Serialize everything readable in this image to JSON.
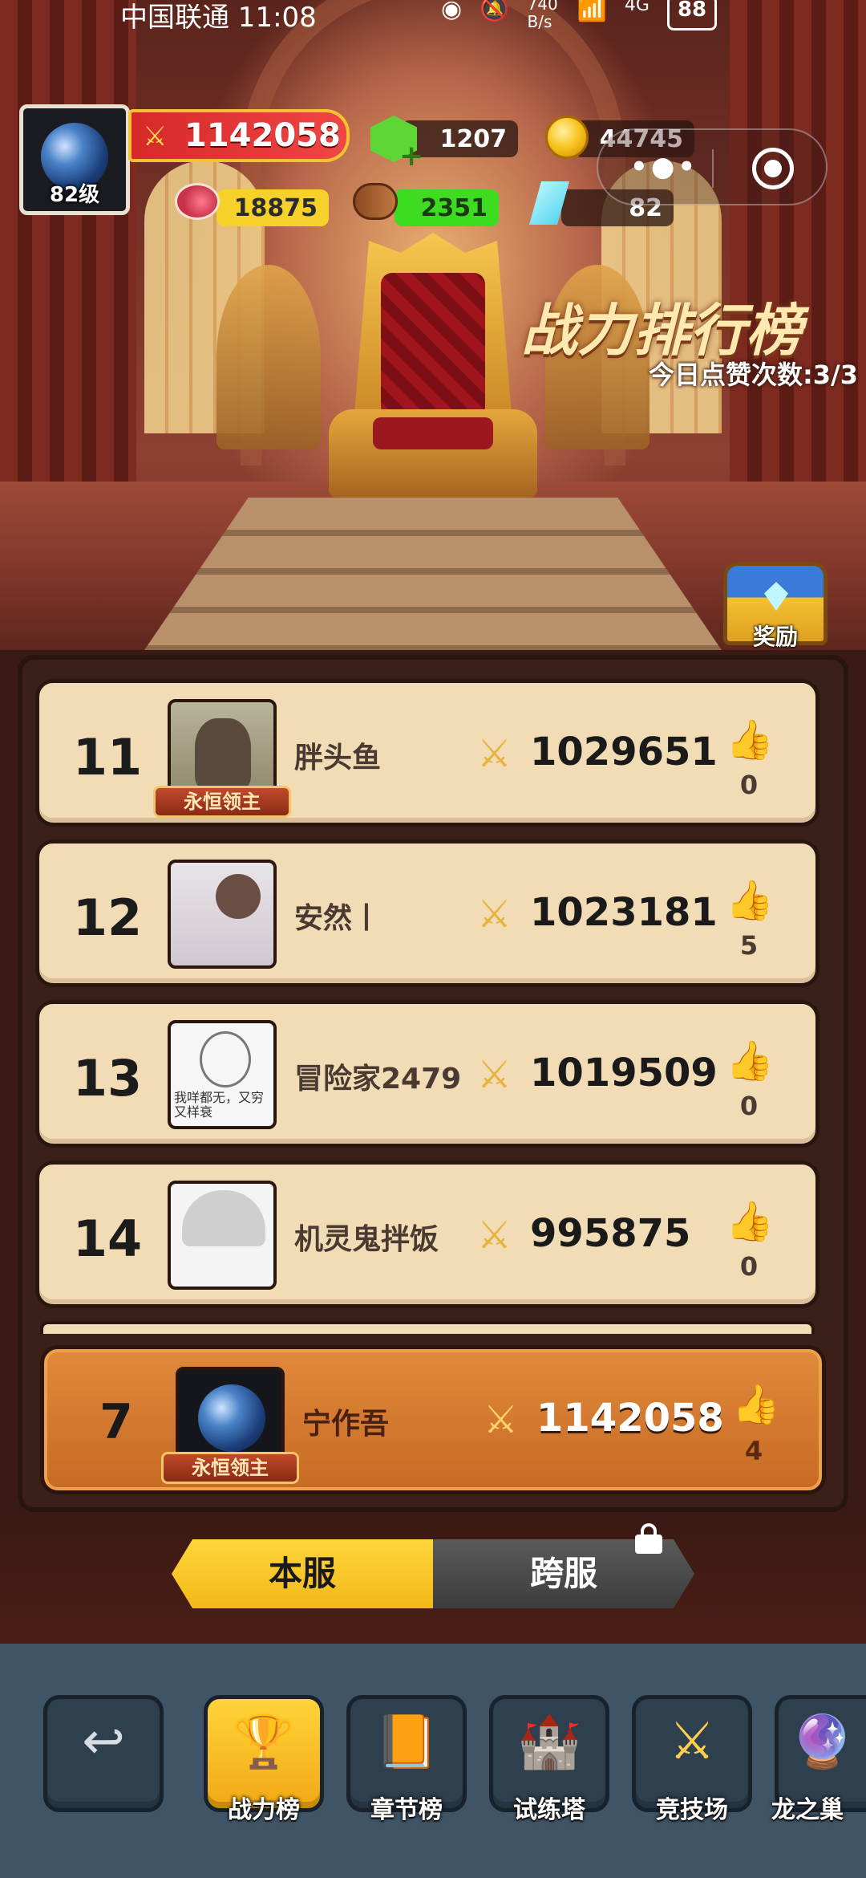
{
  "status_bar": {
    "carrier_time": "中国联通 11:08",
    "net_speed": "740 B/s",
    "network": "4G",
    "battery": "88"
  },
  "player": {
    "level": "82级",
    "power": "1142058"
  },
  "resources": {
    "green_gem": "1207",
    "gold": "44745",
    "food": "18875",
    "wood": "2351",
    "diamond": "82"
  },
  "capsule": {
    "more_icon": "more-dots-icon",
    "close_icon": "target-circle-icon"
  },
  "board": {
    "title": "战力排行榜",
    "likes_today": "今日点赞次数:3/3",
    "reward_label": "奖励"
  },
  "rows": [
    {
      "rank": "11",
      "name": "胖头鱼",
      "power": "1029651",
      "likes": "0",
      "tag": "永恒领主"
    },
    {
      "rank": "12",
      "name": "安然丨",
      "power": "1023181",
      "likes": "5"
    },
    {
      "rank": "13",
      "name": "冒险家2479",
      "power": "1019509",
      "likes": "0",
      "avatar_caption": "我咩都无，又穷又样衰"
    },
    {
      "rank": "14",
      "name": "机灵鬼拌饭",
      "power": "995875",
      "likes": "0"
    }
  ],
  "self_row": {
    "rank": "7",
    "name": "宁作吾",
    "power": "1142058",
    "likes": "4",
    "tag": "永恒领主"
  },
  "server_switch": {
    "local": "本服",
    "cross": "跨服"
  },
  "nav": {
    "back": "",
    "power_rank": "战力榜",
    "chapter_rank": "章节榜",
    "trial_tower": "试练塔",
    "arena": "竞技场",
    "dragon_nest": "龙之巢"
  }
}
